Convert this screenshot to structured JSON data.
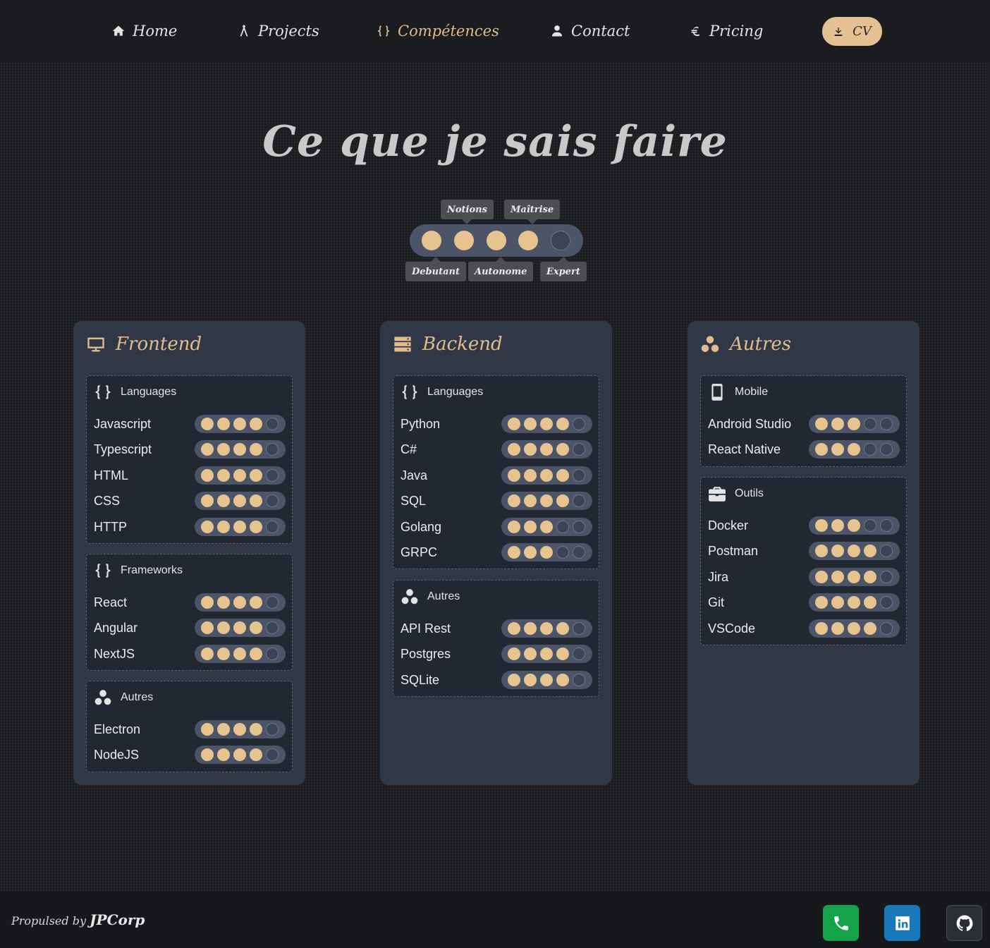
{
  "nav": {
    "items": [
      {
        "label": "Home",
        "icon": "home-icon"
      },
      {
        "label": "Projects",
        "icon": "compass-icon"
      },
      {
        "label": "Compétences",
        "icon": "braces-icon",
        "active": true
      },
      {
        "label": "Contact",
        "icon": "user-icon"
      },
      {
        "label": "Pricing",
        "icon": "euro-icon"
      }
    ],
    "cv_label": "CV"
  },
  "title": "Ce que je sais faire",
  "legend": {
    "max": 5,
    "value": 4,
    "levels": [
      "Debutant",
      "Notions",
      "Autonome",
      "Maîtrise",
      "Expert"
    ]
  },
  "columns": [
    {
      "title": "Frontend",
      "icon": "monitor-icon",
      "groups": [
        {
          "title": "Languages",
          "icon": "braces-icon",
          "skills": [
            {
              "name": "Javascript",
              "level": 4
            },
            {
              "name": "Typescript",
              "level": 4
            },
            {
              "name": "HTML",
              "level": 4
            },
            {
              "name": "CSS",
              "level": 4
            },
            {
              "name": "HTTP",
              "level": 4
            }
          ]
        },
        {
          "title": "Frameworks",
          "icon": "braces-icon",
          "skills": [
            {
              "name": "React",
              "level": 4
            },
            {
              "name": "Angular",
              "level": 4
            },
            {
              "name": "NextJS",
              "level": 4
            }
          ]
        },
        {
          "title": "Autres",
          "icon": "circles-icon",
          "skills": [
            {
              "name": "Electron",
              "level": 4
            },
            {
              "name": "NodeJS",
              "level": 4
            }
          ]
        }
      ]
    },
    {
      "title": "Backend",
      "icon": "server-icon",
      "groups": [
        {
          "title": "Languages",
          "icon": "braces-icon",
          "skills": [
            {
              "name": "Python",
              "level": 4
            },
            {
              "name": "C#",
              "level": 4
            },
            {
              "name": "Java",
              "level": 4
            },
            {
              "name": "SQL",
              "level": 4
            },
            {
              "name": "Golang",
              "level": 3
            },
            {
              "name": "GRPC",
              "level": 3
            }
          ]
        },
        {
          "title": "Autres",
          "icon": "circles-icon",
          "skills": [
            {
              "name": "API Rest",
              "level": 4
            },
            {
              "name": "Postgres",
              "level": 4
            },
            {
              "name": "SQLite",
              "level": 4
            }
          ]
        }
      ]
    },
    {
      "title": "Autres",
      "icon": "circles-icon",
      "groups": [
        {
          "title": "Mobile",
          "icon": "mobile-icon",
          "skills": [
            {
              "name": "Android Studio",
              "level": 3
            },
            {
              "name": "React Native",
              "level": 3
            }
          ]
        },
        {
          "title": "Outils",
          "icon": "toolbox-icon",
          "skills": [
            {
              "name": "Docker",
              "level": 3
            },
            {
              "name": "Postman",
              "level": 4
            },
            {
              "name": "Jira",
              "level": 4
            },
            {
              "name": "Git",
              "level": 4
            },
            {
              "name": "VSCode",
              "level": 4
            }
          ]
        }
      ]
    }
  ],
  "footer": {
    "prefix": "Propulsed by",
    "brand": "JPCorp",
    "socials": [
      {
        "name": "phone",
        "icon": "phone-icon",
        "color": "#15a34a"
      },
      {
        "name": "linkedin",
        "icon": "linkedin-icon",
        "color": "#1878b8"
      },
      {
        "name": "github",
        "icon": "github-icon",
        "color": "#2a2d33"
      }
    ]
  },
  "colors": {
    "accent": "#e0bc8d",
    "dot_filled": "#e6c38f",
    "card": "#303746",
    "group": "#222831"
  }
}
